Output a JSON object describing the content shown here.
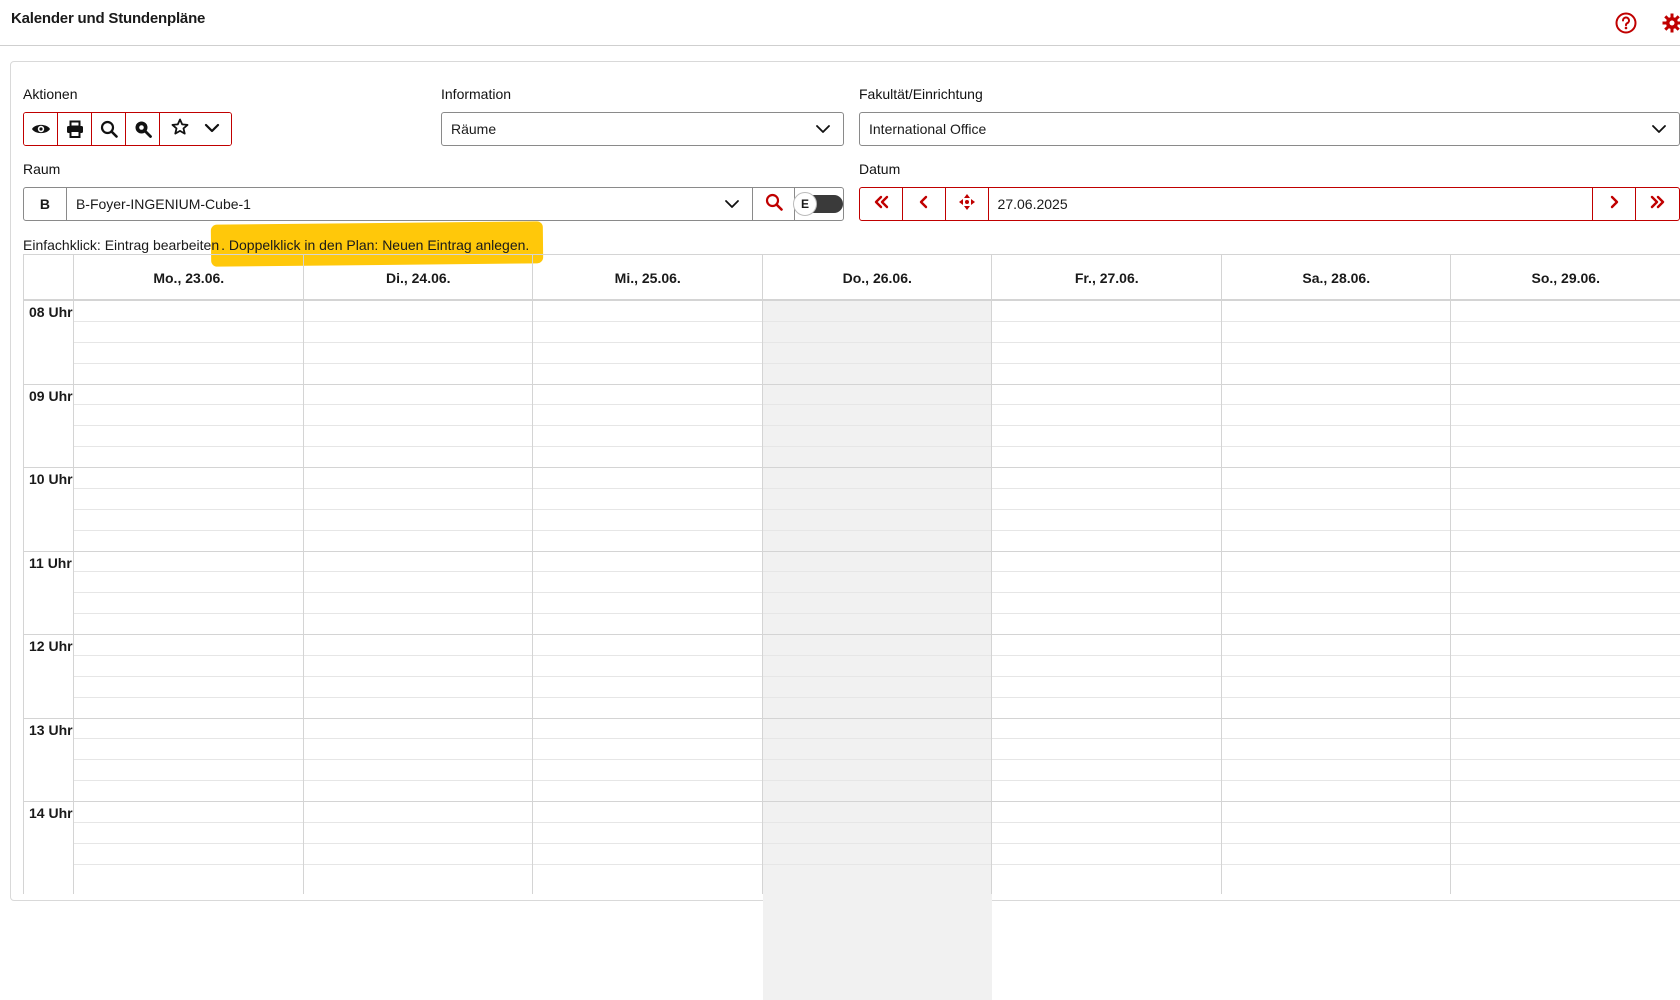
{
  "app": {
    "title": "Kalender und Stundenpläne"
  },
  "header_icons": [
    "help-circle-icon",
    "gear-icon"
  ],
  "colors": {
    "accent": "#c00000",
    "today_shade": "#f1f1f1",
    "highlight": "#ffc80a"
  },
  "filters": {
    "actions_label": "Aktionen",
    "actions_icons": [
      "eye-icon",
      "print-icon",
      "search-icon",
      "zoom-search-icon",
      "star-icon",
      "chevron-down-icon"
    ],
    "information_label": "Information",
    "information_value": "Räume",
    "faculty_label": "Fakultät/Einrichtung",
    "faculty_value": "International Office",
    "room_label": "Raum",
    "room_prefix": "B",
    "room_value": "B-Foyer-INGENIUM-Cube-1",
    "toggle_letter": "E",
    "date_label": "Datum",
    "date_value": "27.06.2025"
  },
  "hint": {
    "part1": "Einfachklick: Eintrag bearbeiten",
    "part2": ". Doppelklick in den Plan: Neuen Eintrag anlegen."
  },
  "calendar": {
    "days": [
      "Mo., 23.06.",
      "Di., 24.06.",
      "Mi., 25.06.",
      "Do., 26.06.",
      "Fr., 27.06.",
      "Sa., 28.06.",
      "So., 29.06."
    ],
    "shaded_day": "Do., 26.06.",
    "hours": [
      "08 Uhr",
      "09 Uhr",
      "10 Uhr",
      "11 Uhr",
      "12 Uhr",
      "13 Uhr",
      "14 Uhr"
    ]
  }
}
